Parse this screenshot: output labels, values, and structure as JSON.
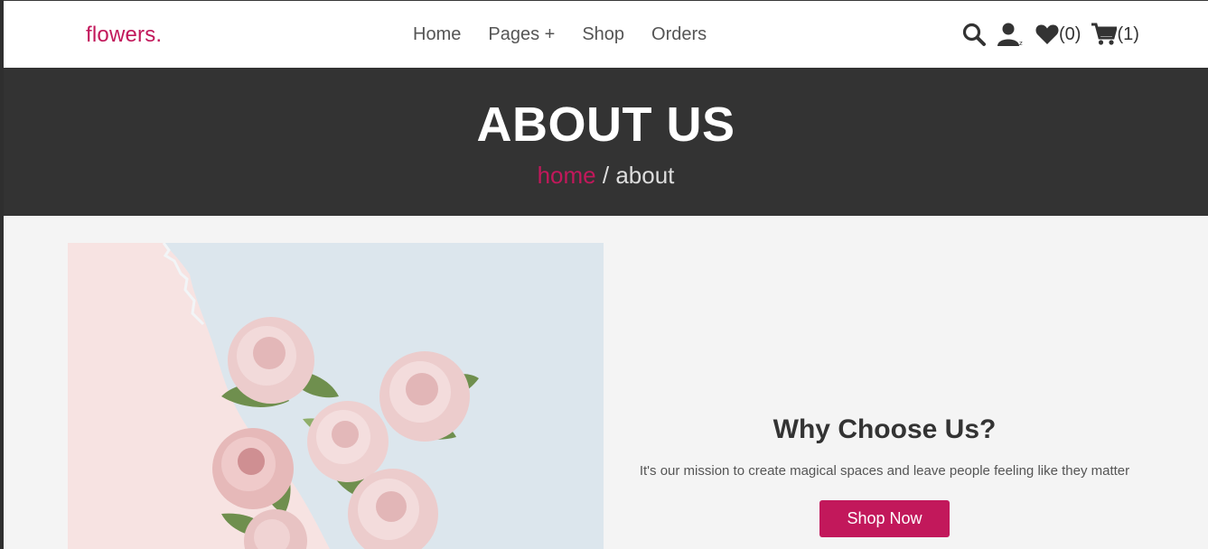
{
  "header": {
    "logo": "flowers.",
    "nav": [
      "Home",
      "Pages +",
      "Shop",
      "Orders"
    ],
    "wishlist_count": "(0)",
    "cart_count": "(1)"
  },
  "banner": {
    "title": "ABOUT US",
    "breadcrumb_home": "home",
    "breadcrumb_separator": "/",
    "breadcrumb_current": "about"
  },
  "about": {
    "heading": "Why Choose Us?",
    "text": "It's our mission to create magical spaces and leave people feeling like they matter",
    "button_label": "Shop Now"
  },
  "colors": {
    "brand": "#c2185b",
    "banner_bg": "#333333",
    "section_bg": "#f4f4f4"
  },
  "icons": [
    "search-icon",
    "user-icon",
    "heart-icon",
    "cart-icon"
  ]
}
